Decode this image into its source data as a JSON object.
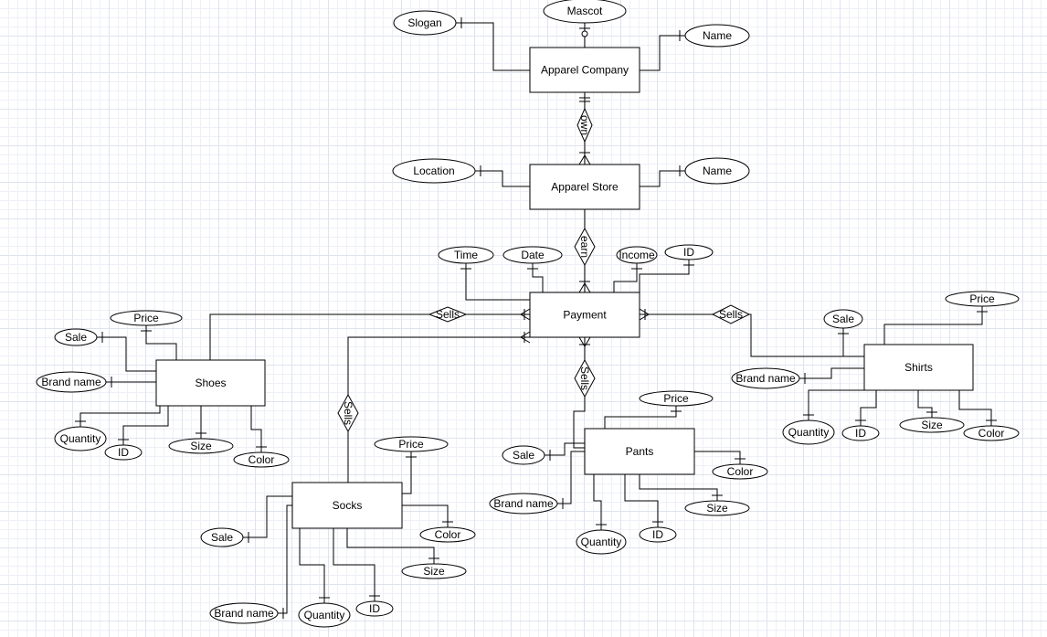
{
  "diagram": {
    "type": "entity-relationship",
    "entities": [
      {
        "id": "apparel_company",
        "label": "Apparel Company"
      },
      {
        "id": "apparel_store",
        "label": "Apparel Store"
      },
      {
        "id": "payment",
        "label": "Payment"
      },
      {
        "id": "shoes",
        "label": "Shoes"
      },
      {
        "id": "shirts",
        "label": "Shirts"
      },
      {
        "id": "pants",
        "label": "Pants"
      },
      {
        "id": "socks",
        "label": "Socks"
      }
    ],
    "relationships": [
      {
        "id": "own",
        "label": "own",
        "from": "apparel_company",
        "to": "apparel_store"
      },
      {
        "id": "earn",
        "label": "earn",
        "from": "apparel_store",
        "to": "payment"
      },
      {
        "id": "sells_shoes",
        "label": "Sells",
        "from": "shoes",
        "to": "payment"
      },
      {
        "id": "sells_shirts",
        "label": "Sells",
        "from": "shirts",
        "to": "payment"
      },
      {
        "id": "sells_pants",
        "label": "Sells",
        "from": "pants",
        "to": "payment"
      },
      {
        "id": "sells_socks",
        "label": "Sells",
        "from": "socks",
        "to": "payment"
      }
    ],
    "attributes": [
      {
        "id": "company_slogan",
        "label": "Slogan",
        "entity": "apparel_company"
      },
      {
        "id": "company_mascot",
        "label": "Mascot",
        "entity": "apparel_company"
      },
      {
        "id": "company_name",
        "label": "Name",
        "entity": "apparel_company"
      },
      {
        "id": "store_location",
        "label": "Location",
        "entity": "apparel_store"
      },
      {
        "id": "store_name",
        "label": "Name",
        "entity": "apparel_store"
      },
      {
        "id": "payment_time",
        "label": "Time",
        "entity": "payment"
      },
      {
        "id": "payment_date",
        "label": "Date",
        "entity": "payment"
      },
      {
        "id": "payment_income",
        "label": "Income",
        "entity": "payment"
      },
      {
        "id": "payment_id",
        "label": "ID",
        "entity": "payment"
      },
      {
        "id": "shoes_price",
        "label": "Price",
        "entity": "shoes"
      },
      {
        "id": "shoes_sale",
        "label": "Sale",
        "entity": "shoes"
      },
      {
        "id": "shoes_brand",
        "label": "Brand name",
        "entity": "shoes"
      },
      {
        "id": "shoes_quantity",
        "label": "Quantity",
        "entity": "shoes"
      },
      {
        "id": "shoes_id",
        "label": "ID",
        "entity": "shoes"
      },
      {
        "id": "shoes_size",
        "label": "Size",
        "entity": "shoes"
      },
      {
        "id": "shoes_color",
        "label": "Color",
        "entity": "shoes"
      },
      {
        "id": "shirts_price",
        "label": "Price",
        "entity": "shirts"
      },
      {
        "id": "shirts_sale",
        "label": "Sale",
        "entity": "shirts"
      },
      {
        "id": "shirts_brand",
        "label": "Brand name",
        "entity": "shirts"
      },
      {
        "id": "shirts_quantity",
        "label": "Quantity",
        "entity": "shirts"
      },
      {
        "id": "shirts_id",
        "label": "ID",
        "entity": "shirts"
      },
      {
        "id": "shirts_size",
        "label": "Size",
        "entity": "shirts"
      },
      {
        "id": "shirts_color",
        "label": "Color",
        "entity": "shirts"
      },
      {
        "id": "pants_price",
        "label": "Price",
        "entity": "pants"
      },
      {
        "id": "pants_sale",
        "label": "Sale",
        "entity": "pants"
      },
      {
        "id": "pants_brand",
        "label": "Brand name",
        "entity": "pants"
      },
      {
        "id": "pants_quantity",
        "label": "Quantity",
        "entity": "pants"
      },
      {
        "id": "pants_id",
        "label": "ID",
        "entity": "pants"
      },
      {
        "id": "pants_size",
        "label": "Size",
        "entity": "pants"
      },
      {
        "id": "pants_color",
        "label": "Color",
        "entity": "pants"
      },
      {
        "id": "socks_price",
        "label": "Price",
        "entity": "socks"
      },
      {
        "id": "socks_sale",
        "label": "Sale",
        "entity": "socks"
      },
      {
        "id": "socks_brand",
        "label": "Brand name",
        "entity": "socks"
      },
      {
        "id": "socks_quantity",
        "label": "Quantity",
        "entity": "socks"
      },
      {
        "id": "socks_id",
        "label": "ID",
        "entity": "socks"
      },
      {
        "id": "socks_size",
        "label": "Size",
        "entity": "socks"
      },
      {
        "id": "socks_color",
        "label": "Color",
        "entity": "socks"
      }
    ]
  }
}
